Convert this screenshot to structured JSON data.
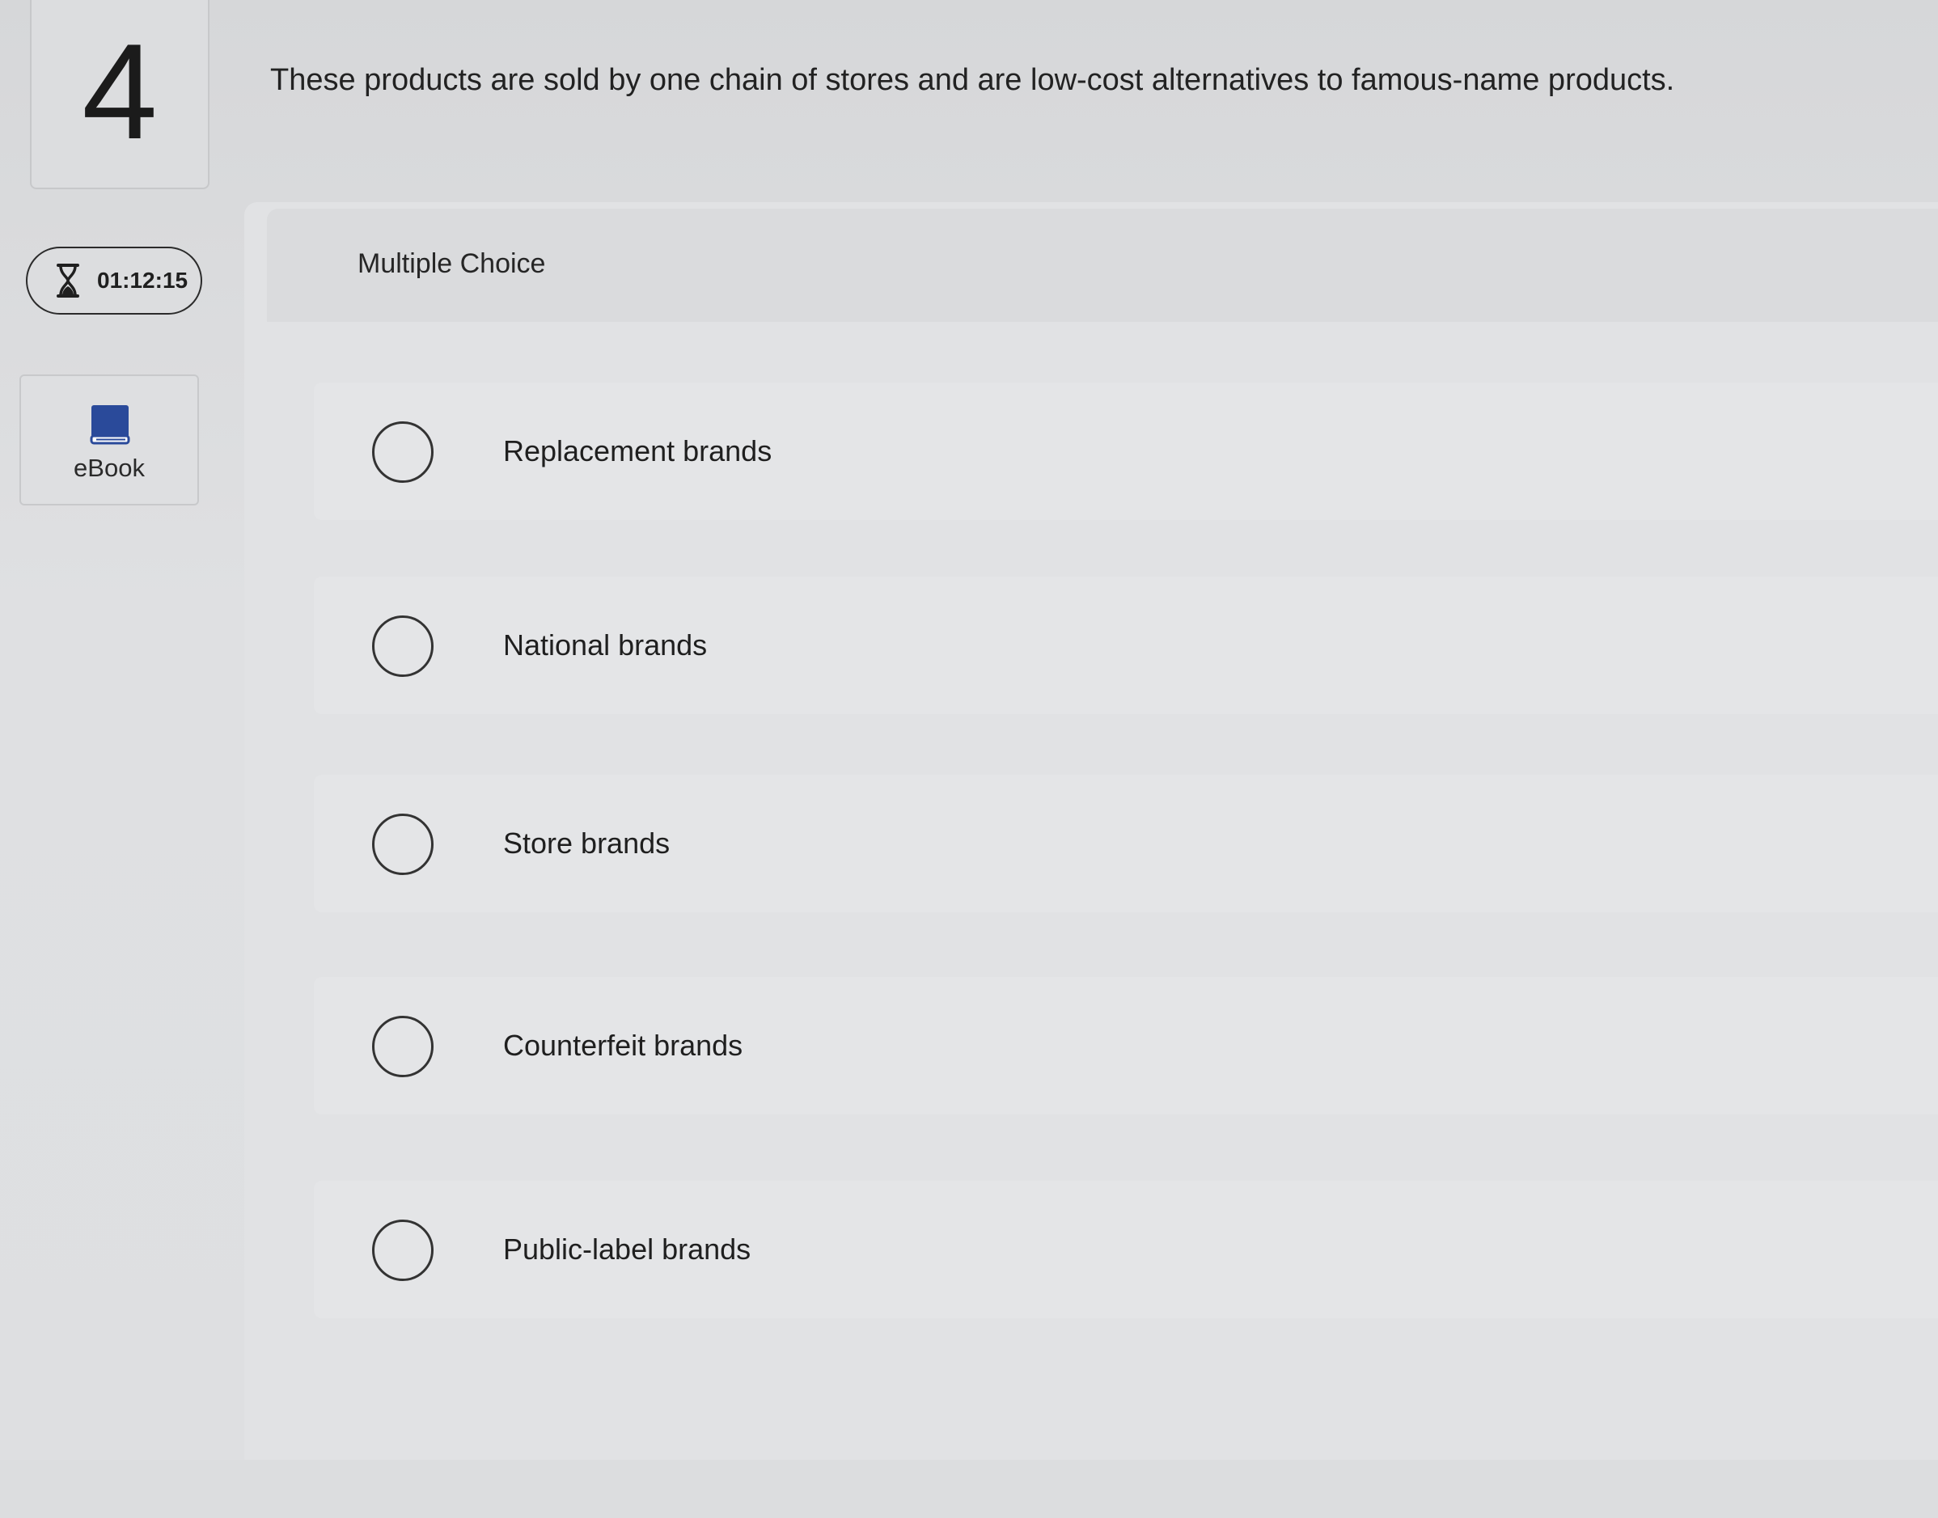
{
  "question": {
    "number": "4",
    "text": "These products are sold by one chain of stores and are low-cost alternatives to famous-name products."
  },
  "timer": {
    "icon": "hourglass-icon",
    "value": "01:12:15"
  },
  "ebook": {
    "icon": "book-icon",
    "label": "eBook",
    "icon_color": "#2a4a9a"
  },
  "question_type": "Multiple Choice",
  "options": [
    {
      "label": "Replacement brands"
    },
    {
      "label": "National brands"
    },
    {
      "label": "Store brands"
    },
    {
      "label": "Counterfeit brands"
    },
    {
      "label": "Public-label brands"
    }
  ]
}
